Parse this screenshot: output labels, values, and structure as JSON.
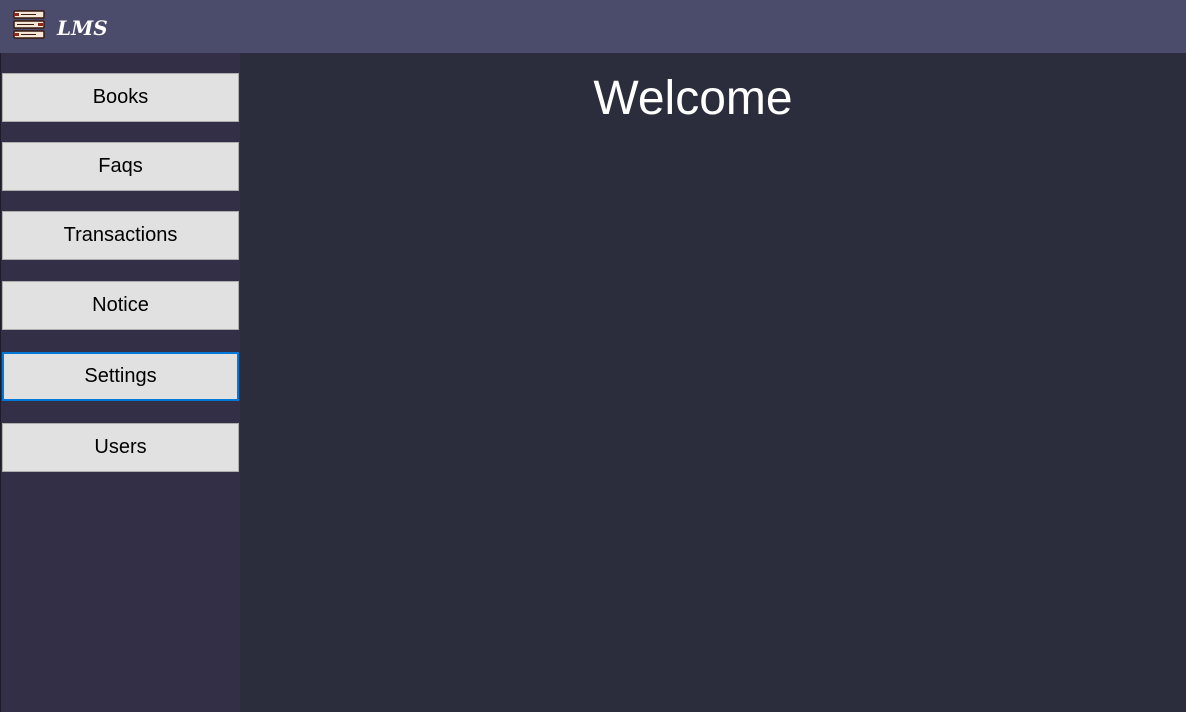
{
  "app": {
    "title": "LMS",
    "icon": "books-stack-icon"
  },
  "sidebar": {
    "items": [
      {
        "label": "Books"
      },
      {
        "label": "Faqs"
      },
      {
        "label": "Transactions"
      },
      {
        "label": "Notice"
      },
      {
        "label": "Settings",
        "focused": true
      },
      {
        "label": "Users"
      }
    ]
  },
  "main": {
    "heading": "Welcome"
  },
  "colors": {
    "titlebar": "#4b4b6c",
    "sidebar": "#332f47",
    "content": "#2c2d3c",
    "button": "#e1e1e1",
    "focus_border": "#0078d7"
  }
}
